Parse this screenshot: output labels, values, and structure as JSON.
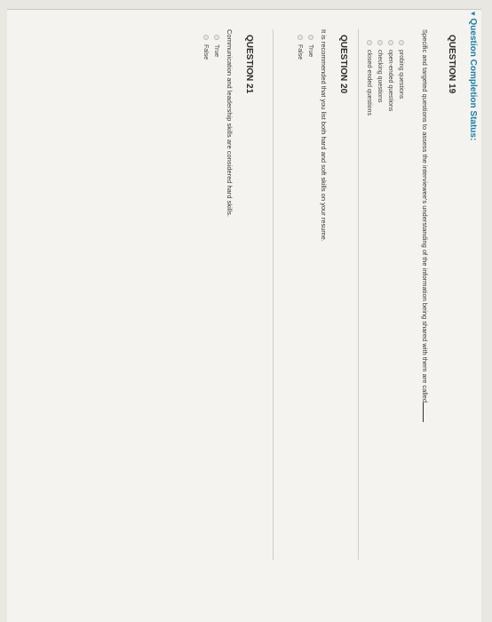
{
  "status": {
    "label": "Question Completion Status:"
  },
  "questions": [
    {
      "heading": "QUESTION 19",
      "text": "Specific and targeted questions to assess the interviewee's understanding of the information being shared with them are called",
      "options": [
        "probing questions",
        "open-ended questions",
        "checking questions",
        "closed-ended questions"
      ]
    },
    {
      "heading": "QUESTION 20",
      "text": "It is recommended that you list both hard and soft skills on your resume.",
      "options": [
        "True",
        "False"
      ]
    },
    {
      "heading": "QUESTION 21",
      "text": "Communication and leadership skills are considered hard skills.",
      "options": [
        "True",
        "False"
      ]
    }
  ]
}
